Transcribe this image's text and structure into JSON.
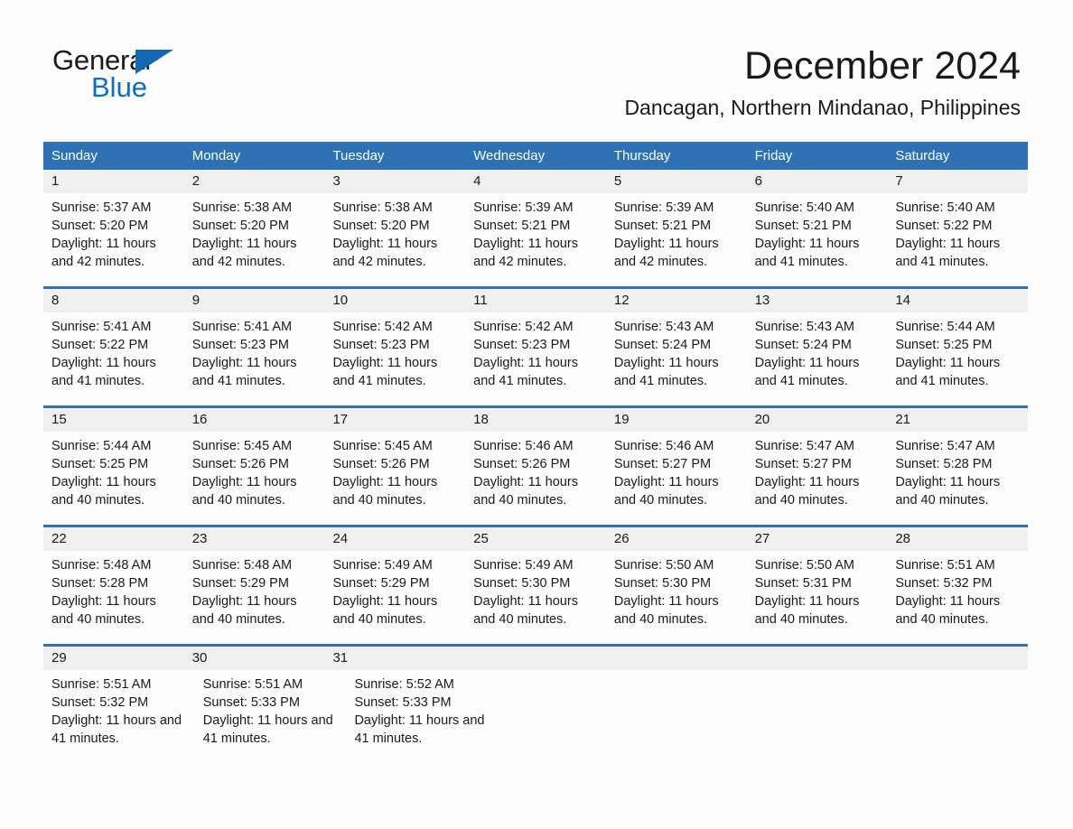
{
  "logo": {
    "word_one": "General",
    "word_two": "Blue",
    "triangle_icon": "triangle-icon",
    "brand_blue": "#0a6fc2",
    "triangle_blue": "#1569b0"
  },
  "header": {
    "title": "December 2024",
    "subtitle": "Dancagan, Northern Mindanao, Philippines"
  },
  "colors": {
    "header_blue": "#2e71b5",
    "row_divider_blue": "#2e71b5",
    "daynum_band_gray": "#f0f0f0",
    "text": "#1a1a1a",
    "page_background": "#fdfdfd"
  },
  "calendar": {
    "weekdays": [
      "Sunday",
      "Monday",
      "Tuesday",
      "Wednesday",
      "Thursday",
      "Friday",
      "Saturday"
    ],
    "weeks": [
      {
        "days": [
          {
            "day": "1",
            "sunrise": "Sunrise: 5:37 AM",
            "sunset": "Sunset: 5:20 PM",
            "daylight": "Daylight: 11 hours and 42 minutes."
          },
          {
            "day": "2",
            "sunrise": "Sunrise: 5:38 AM",
            "sunset": "Sunset: 5:20 PM",
            "daylight": "Daylight: 11 hours and 42 minutes."
          },
          {
            "day": "3",
            "sunrise": "Sunrise: 5:38 AM",
            "sunset": "Sunset: 5:20 PM",
            "daylight": "Daylight: 11 hours and 42 minutes."
          },
          {
            "day": "4",
            "sunrise": "Sunrise: 5:39 AM",
            "sunset": "Sunset: 5:21 PM",
            "daylight": "Daylight: 11 hours and 42 minutes."
          },
          {
            "day": "5",
            "sunrise": "Sunrise: 5:39 AM",
            "sunset": "Sunset: 5:21 PM",
            "daylight": "Daylight: 11 hours and 42 minutes."
          },
          {
            "day": "6",
            "sunrise": "Sunrise: 5:40 AM",
            "sunset": "Sunset: 5:21 PM",
            "daylight": "Daylight: 11 hours and 41 minutes."
          },
          {
            "day": "7",
            "sunrise": "Sunrise: 5:40 AM",
            "sunset": "Sunset: 5:22 PM",
            "daylight": "Daylight: 11 hours and 41 minutes."
          }
        ]
      },
      {
        "days": [
          {
            "day": "8",
            "sunrise": "Sunrise: 5:41 AM",
            "sunset": "Sunset: 5:22 PM",
            "daylight": "Daylight: 11 hours and 41 minutes."
          },
          {
            "day": "9",
            "sunrise": "Sunrise: 5:41 AM",
            "sunset": "Sunset: 5:23 PM",
            "daylight": "Daylight: 11 hours and 41 minutes."
          },
          {
            "day": "10",
            "sunrise": "Sunrise: 5:42 AM",
            "sunset": "Sunset: 5:23 PM",
            "daylight": "Daylight: 11 hours and 41 minutes."
          },
          {
            "day": "11",
            "sunrise": "Sunrise: 5:42 AM",
            "sunset": "Sunset: 5:23 PM",
            "daylight": "Daylight: 11 hours and 41 minutes."
          },
          {
            "day": "12",
            "sunrise": "Sunrise: 5:43 AM",
            "sunset": "Sunset: 5:24 PM",
            "daylight": "Daylight: 11 hours and 41 minutes."
          },
          {
            "day": "13",
            "sunrise": "Sunrise: 5:43 AM",
            "sunset": "Sunset: 5:24 PM",
            "daylight": "Daylight: 11 hours and 41 minutes."
          },
          {
            "day": "14",
            "sunrise": "Sunrise: 5:44 AM",
            "sunset": "Sunset: 5:25 PM",
            "daylight": "Daylight: 11 hours and 41 minutes."
          }
        ]
      },
      {
        "days": [
          {
            "day": "15",
            "sunrise": "Sunrise: 5:44 AM",
            "sunset": "Sunset: 5:25 PM",
            "daylight": "Daylight: 11 hours and 40 minutes."
          },
          {
            "day": "16",
            "sunrise": "Sunrise: 5:45 AM",
            "sunset": "Sunset: 5:26 PM",
            "daylight": "Daylight: 11 hours and 40 minutes."
          },
          {
            "day": "17",
            "sunrise": "Sunrise: 5:45 AM",
            "sunset": "Sunset: 5:26 PM",
            "daylight": "Daylight: 11 hours and 40 minutes."
          },
          {
            "day": "18",
            "sunrise": "Sunrise: 5:46 AM",
            "sunset": "Sunset: 5:26 PM",
            "daylight": "Daylight: 11 hours and 40 minutes."
          },
          {
            "day": "19",
            "sunrise": "Sunrise: 5:46 AM",
            "sunset": "Sunset: 5:27 PM",
            "daylight": "Daylight: 11 hours and 40 minutes."
          },
          {
            "day": "20",
            "sunrise": "Sunrise: 5:47 AM",
            "sunset": "Sunset: 5:27 PM",
            "daylight": "Daylight: 11 hours and 40 minutes."
          },
          {
            "day": "21",
            "sunrise": "Sunrise: 5:47 AM",
            "sunset": "Sunset: 5:28 PM",
            "daylight": "Daylight: 11 hours and 40 minutes."
          }
        ]
      },
      {
        "days": [
          {
            "day": "22",
            "sunrise": "Sunrise: 5:48 AM",
            "sunset": "Sunset: 5:28 PM",
            "daylight": "Daylight: 11 hours and 40 minutes."
          },
          {
            "day": "23",
            "sunrise": "Sunrise: 5:48 AM",
            "sunset": "Sunset: 5:29 PM",
            "daylight": "Daylight: 11 hours and 40 minutes."
          },
          {
            "day": "24",
            "sunrise": "Sunrise: 5:49 AM",
            "sunset": "Sunset: 5:29 PM",
            "daylight": "Daylight: 11 hours and 40 minutes."
          },
          {
            "day": "25",
            "sunrise": "Sunrise: 5:49 AM",
            "sunset": "Sunset: 5:30 PM",
            "daylight": "Daylight: 11 hours and 40 minutes."
          },
          {
            "day": "26",
            "sunrise": "Sunrise: 5:50 AM",
            "sunset": "Sunset: 5:30 PM",
            "daylight": "Daylight: 11 hours and 40 minutes."
          },
          {
            "day": "27",
            "sunrise": "Sunrise: 5:50 AM",
            "sunset": "Sunset: 5:31 PM",
            "daylight": "Daylight: 11 hours and 40 minutes."
          },
          {
            "day": "28",
            "sunrise": "Sunrise: 5:51 AM",
            "sunset": "Sunset: 5:32 PM",
            "daylight": "Daylight: 11 hours and 40 minutes."
          }
        ]
      },
      {
        "days": [
          {
            "day": "29",
            "sunrise": "Sunrise: 5:51 AM",
            "sunset": "Sunset: 5:32 PM",
            "daylight": "Daylight: 11 hours and 41 minutes."
          },
          {
            "day": "30",
            "sunrise": "Sunrise: 5:51 AM",
            "sunset": "Sunset: 5:33 PM",
            "daylight": "Daylight: 11 hours and 41 minutes."
          },
          {
            "day": "31",
            "sunrise": "Sunrise: 5:52 AM",
            "sunset": "Sunset: 5:33 PM",
            "daylight": "Daylight: 11 hours and 41 minutes."
          },
          {
            "day": "",
            "sunrise": "",
            "sunset": "",
            "daylight": ""
          },
          {
            "day": "",
            "sunrise": "",
            "sunset": "",
            "daylight": ""
          },
          {
            "day": "",
            "sunrise": "",
            "sunset": "",
            "daylight": ""
          },
          {
            "day": "",
            "sunrise": "",
            "sunset": "",
            "daylight": ""
          }
        ]
      }
    ]
  }
}
